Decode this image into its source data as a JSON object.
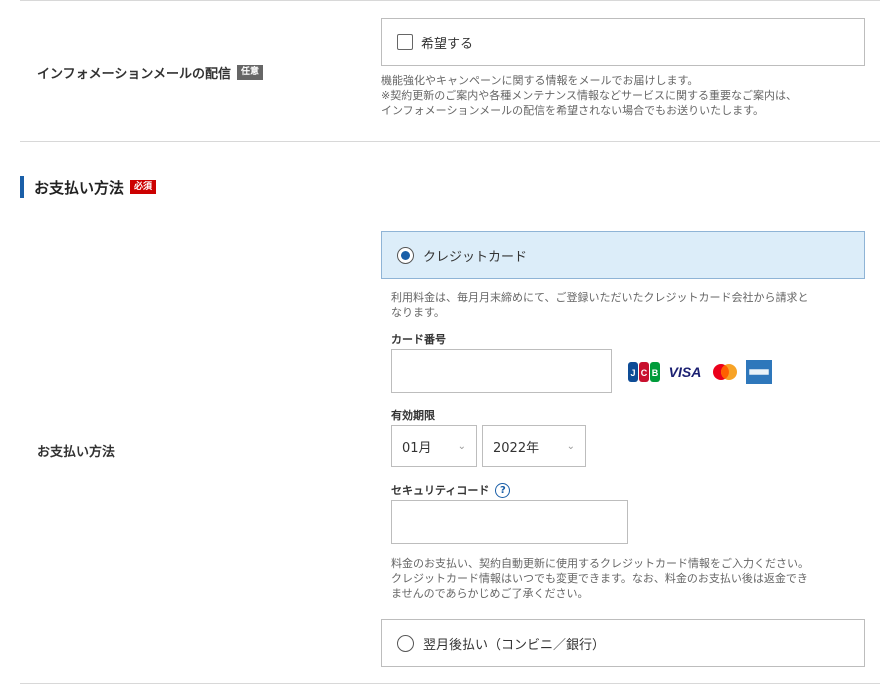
{
  "newsletter": {
    "label": "インフォメーションメールの配信",
    "tag": "任意",
    "checkbox_label": "希望する",
    "note": [
      "機能強化やキャンペーンに関する情報をメールでお届けします。",
      "※契約更新のご案内や各種メンテナンス情報などサービスに関する重要なご案内は、",
      "インフォメーションメールの配信を希望されない場合でもお送りいたします。"
    ]
  },
  "payment_section": {
    "heading": "お支払い方法",
    "tag": "必須"
  },
  "payment": {
    "row_label": "お支払い方法",
    "credit_option_label": "クレジットカード",
    "credit_note": [
      "利用料金は、毎月月末締めにて、ご登録いただいたクレジットカード会社から請求と",
      "なります。"
    ],
    "card_number_label": "カード番号",
    "card_number_value": "",
    "card_brands": [
      "JCB",
      "VISA",
      "Mastercard",
      "American Express"
    ],
    "expiry_label": "有効期限",
    "expiry_month": "01月",
    "expiry_year": "2022年",
    "security_code_label": "セキュリティコード",
    "security_help": "?",
    "security_code_value": "",
    "security_note": [
      "料金のお支払い、契約自動更新に使用するクレジットカード情報をご入力ください。",
      "クレジットカード情報はいつでも変更できます。なお、料金のお支払い後は返金でき",
      "ませんのであらかじめご了承ください。"
    ],
    "deferred_option_label": "翌月後払い（コンビニ／銀行）"
  },
  "colors": {
    "accent": "#1a5fa8",
    "selected_bg": "#dcedf9",
    "required_tag": "#cc0000",
    "optional_tag": "#666666"
  }
}
